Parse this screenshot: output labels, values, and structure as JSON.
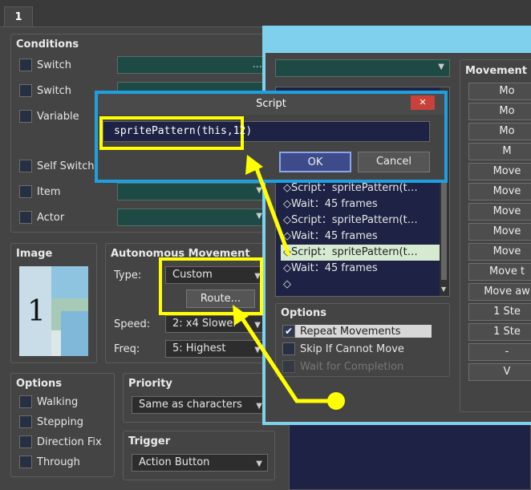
{
  "tab": {
    "label": "1"
  },
  "conditions": {
    "title": "Conditions",
    "items": [
      {
        "label": "Switch",
        "value": "..."
      },
      {
        "label": "Switch"
      },
      {
        "label": "Variable"
      },
      {
        "label": "Self Switch"
      },
      {
        "label": "Item"
      },
      {
        "label": "Actor"
      }
    ]
  },
  "image": {
    "title": "Image",
    "sprite_label": "1"
  },
  "autonomous": {
    "title": "Autonomous Movement",
    "type_label": "Type:",
    "type_value": "Custom",
    "route_button": "Route...",
    "speed_label": "Speed:",
    "speed_value": "2: x4 Slower",
    "freq_label": "Freq:",
    "freq_value": "5: Highest"
  },
  "options": {
    "title": "Options",
    "items": [
      {
        "label": "Walking"
      },
      {
        "label": "Stepping"
      },
      {
        "label": "Direction Fix"
      },
      {
        "label": "Through"
      }
    ]
  },
  "priority": {
    "title": "Priority",
    "value": "Same as characters"
  },
  "trigger": {
    "title": "Trigger",
    "value": "Action Button"
  },
  "route_window": {
    "list": [
      "◇Script：spritePattern(t…",
      "◇Wait：45 frames",
      "◇Script：spritePattern(t…",
      "◇Wait：45 frames",
      "◇Script：spritePattern(t…",
      "◇Wait：45 frames",
      "◇"
    ],
    "options_title": "Options",
    "repeat": "Repeat Movements",
    "skip": "Skip If Cannot Move",
    "wait": "Wait for Completion",
    "movement_title": "Movement C",
    "movement_buttons": [
      "Mo",
      "Mo",
      "Mo",
      "M",
      "Move",
      "Move",
      "Move",
      "Move",
      "Move",
      "Move t",
      "Move aw",
      "1 Ste",
      "1 Ste",
      "-",
      "V"
    ]
  },
  "script_dialog": {
    "title": "Script",
    "close": "✕",
    "input_value": "spritePattern(this,12)",
    "ok": "OK",
    "cancel": "Cancel"
  },
  "colors": {
    "annotation": "#ffff00",
    "highlight_border": "#1ea0e0"
  }
}
